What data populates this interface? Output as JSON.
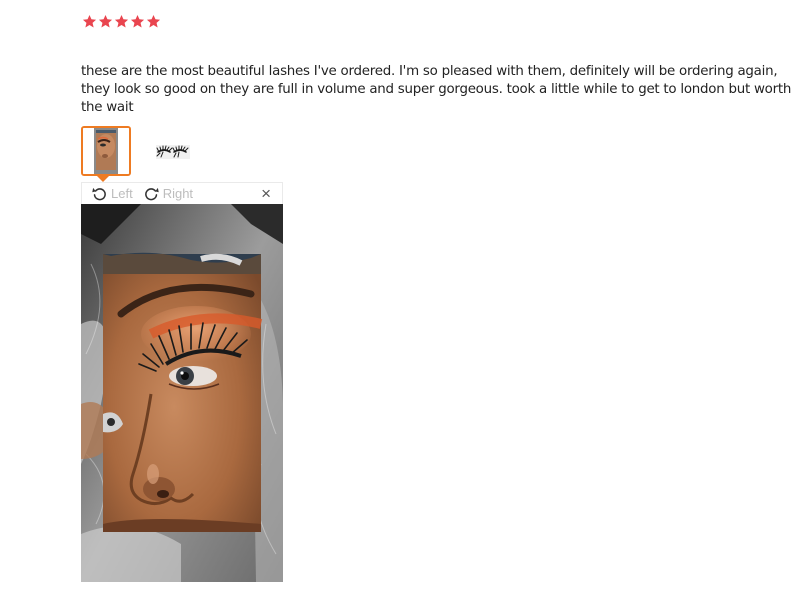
{
  "review": {
    "rating": 5,
    "max_rating": 5,
    "star_color": "#e9454f",
    "text": "these are the most beautiful lashes I've ordered. I'm so pleased with them, definitely will be ordering again, they look so good on they are full in volume and super gorgeous. took a little while to get to london but worth the wait"
  },
  "thumbnails": [
    {
      "name": "photo-face",
      "active": true
    },
    {
      "name": "photo-lashes",
      "active": false
    }
  ],
  "viewer": {
    "rotate_left_label": "Left",
    "rotate_right_label": "Right",
    "close_glyph": "×",
    "icons": [
      "rotate-left-icon",
      "rotate-right-icon",
      "close-icon"
    ]
  },
  "colors": {
    "accent": "#ee7b22",
    "toolbar_text": "#bdbdbd"
  }
}
